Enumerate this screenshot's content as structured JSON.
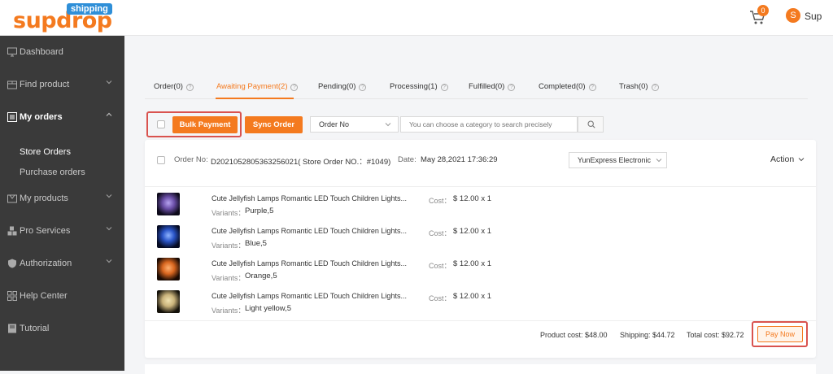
{
  "brand": {
    "logo_text": "supdrop",
    "logo_badge": "shipping",
    "accent": "#f47a1f"
  },
  "header": {
    "cart_count": "0",
    "avatar_initial": "S",
    "user_name": "Sup"
  },
  "sidebar": {
    "items": [
      {
        "label": "Dashboard",
        "icon": "monitor-icon"
      },
      {
        "label": "Find product",
        "icon": "box-icon"
      },
      {
        "label": "My orders",
        "icon": "list-icon"
      },
      {
        "label": "My products",
        "icon": "product-icon"
      },
      {
        "label": "Pro Services",
        "icon": "cubes-icon"
      },
      {
        "label": "Authorization",
        "icon": "shield-icon"
      },
      {
        "label": "Help Center",
        "icon": "grid-icon"
      },
      {
        "label": "Tutorial",
        "icon": "book-icon"
      }
    ],
    "sub_items": [
      {
        "label": "Store Orders"
      },
      {
        "label": "Purchase orders"
      }
    ]
  },
  "tabs": [
    {
      "label": "Order(0)"
    },
    {
      "label": "Awaiting Payment(2)"
    },
    {
      "label": "Pending(0)"
    },
    {
      "label": "Processing(1)"
    },
    {
      "label": "Fulfilled(0)"
    },
    {
      "label": "Completed(0)"
    },
    {
      "label": "Trash(0)"
    }
  ],
  "toolbar": {
    "bulk_payment": "Bulk Payment",
    "sync_order": "Sync Order",
    "category_select": "Order No",
    "search_placeholder": "You can choose a category to search precisely"
  },
  "order": {
    "order_no_label": "Order No:",
    "order_no": "D2021052805363256021( Store Order NO.：#1049)",
    "date_label": "Date:",
    "date": "May 28,2021 17:36:29",
    "shipping_method": "YunExpress Electronic",
    "action_label": "Action",
    "items": [
      {
        "title": "Cute Jellyfish Lamps Romantic LED Touch Children Lights...",
        "variants_label": "Variants：",
        "variant": "Purple,5",
        "cost_label": "Cost：",
        "cost": "$ 12.00 x 1",
        "color": "#6b4fa8"
      },
      {
        "title": "Cute Jellyfish Lamps Romantic LED Touch Children Lights...",
        "variants_label": "Variants：",
        "variant": "Blue,5",
        "cost_label": "Cost：",
        "cost": "$ 12.00 x 1",
        "color": "#2a55c8"
      },
      {
        "title": "Cute Jellyfish Lamps Romantic LED Touch Children Lights...",
        "variants_label": "Variants：",
        "variant": "Orange,5",
        "cost_label": "Cost：",
        "cost": "$ 12.00 x 1",
        "color": "#d9661f"
      },
      {
        "title": "Cute Jellyfish Lamps Romantic LED Touch Children Lights...",
        "variants_label": "Variants：",
        "variant": "Light yellow,5",
        "cost_label": "Cost：",
        "cost": "$ 12.00 x 1",
        "color": "#c9b27a"
      }
    ],
    "product_cost": "Product cost: $48.00",
    "shipping_cost": "Shipping: $44.72",
    "total_cost": "Total cost: $92.72",
    "pay_now": "Pay Now"
  }
}
